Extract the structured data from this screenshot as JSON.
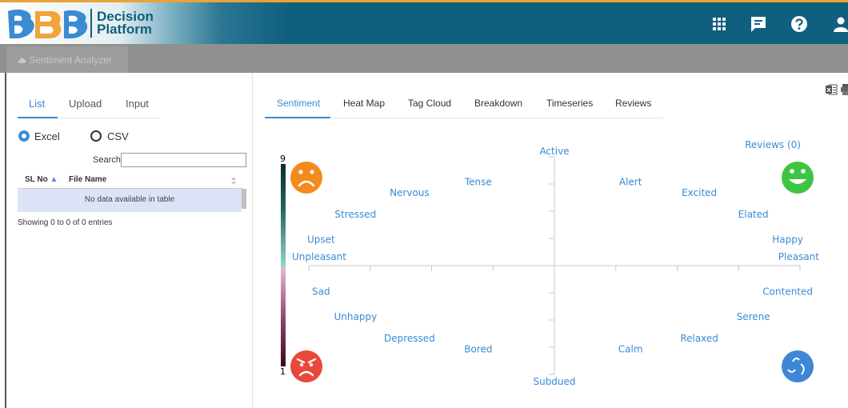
{
  "brand": {
    "name_line1": "Decision",
    "name_line2": "Platform"
  },
  "header_icons": [
    "apps-grid-icon",
    "chat-icon",
    "help-icon",
    "user-icon"
  ],
  "app_tab": {
    "label": "Sentiment Analyzer",
    "icon": "cloud-icon"
  },
  "left_tabs": [
    {
      "label": "List"
    },
    {
      "label": "Upload"
    },
    {
      "label": "Input"
    }
  ],
  "file_type": {
    "options": [
      {
        "label": "Excel"
      },
      {
        "label": "CSV"
      }
    ],
    "selected": "Excel"
  },
  "search": {
    "label": "Search",
    "value": ""
  },
  "table": {
    "columns": [
      {
        "label": "SL No"
      },
      {
        "label": "File Name"
      }
    ],
    "empty_message": "No data available in table",
    "info": "Showing 0 to 0 of 0 entries"
  },
  "content_tabs": [
    {
      "label": "Sentiment"
    },
    {
      "label": "Heat Map"
    },
    {
      "label": "Tag Cloud"
    },
    {
      "label": "Breakdown"
    },
    {
      "label": "Timeseries"
    },
    {
      "label": "Reviews"
    }
  ],
  "tool_icons": [
    "excel-export-icon",
    "print-icon"
  ],
  "colors": {
    "header": "#0f5f7e",
    "accent": "#3a8bd4",
    "label": "#3a8bd4",
    "scale_top": "#0f2b2e",
    "scale_bottom": "#3a0a1e",
    "face_unpleasant_active": "#f28b1c",
    "face_pleasant_active": "#3ec444",
    "face_unpleasant_subdued": "#e8483a",
    "face_pleasant_subdued": "#3f86d6"
  },
  "chart_data": {
    "type": "scatter",
    "reviews_label": "Reviews (0)",
    "scale": {
      "min": "1",
      "max": "9"
    },
    "xlim": [
      -1,
      1
    ],
    "ylim": [
      -1,
      1
    ],
    "x_ticks": 8,
    "y_ticks": 8,
    "axis_labels": {
      "left": "Unpleasant",
      "right": "Pleasant",
      "top": "Active",
      "bottom": "Subdued"
    },
    "labels": [
      {
        "text": "Tense",
        "x": -0.31,
        "y": 0.77
      },
      {
        "text": "Nervous",
        "x": -0.59,
        "y": 0.67
      },
      {
        "text": "Stressed",
        "x": -0.81,
        "y": 0.47
      },
      {
        "text": "Upset",
        "x": -0.95,
        "y": 0.24
      },
      {
        "text": "Alert",
        "x": 0.31,
        "y": 0.77
      },
      {
        "text": "Excited",
        "x": 0.59,
        "y": 0.67
      },
      {
        "text": "Elated",
        "x": 0.81,
        "y": 0.47
      },
      {
        "text": "Happy",
        "x": 0.95,
        "y": 0.24
      },
      {
        "text": "Sad",
        "x": -0.95,
        "y": -0.24
      },
      {
        "text": "Unhappy",
        "x": -0.81,
        "y": -0.47
      },
      {
        "text": "Depressed",
        "x": -0.59,
        "y": -0.67
      },
      {
        "text": "Bored",
        "x": -0.31,
        "y": -0.77
      },
      {
        "text": "Contented",
        "x": 0.95,
        "y": -0.24
      },
      {
        "text": "Serene",
        "x": 0.81,
        "y": -0.47
      },
      {
        "text": "Relaxed",
        "x": 0.59,
        "y": -0.67
      },
      {
        "text": "Calm",
        "x": 0.31,
        "y": -0.77
      }
    ],
    "points": []
  }
}
